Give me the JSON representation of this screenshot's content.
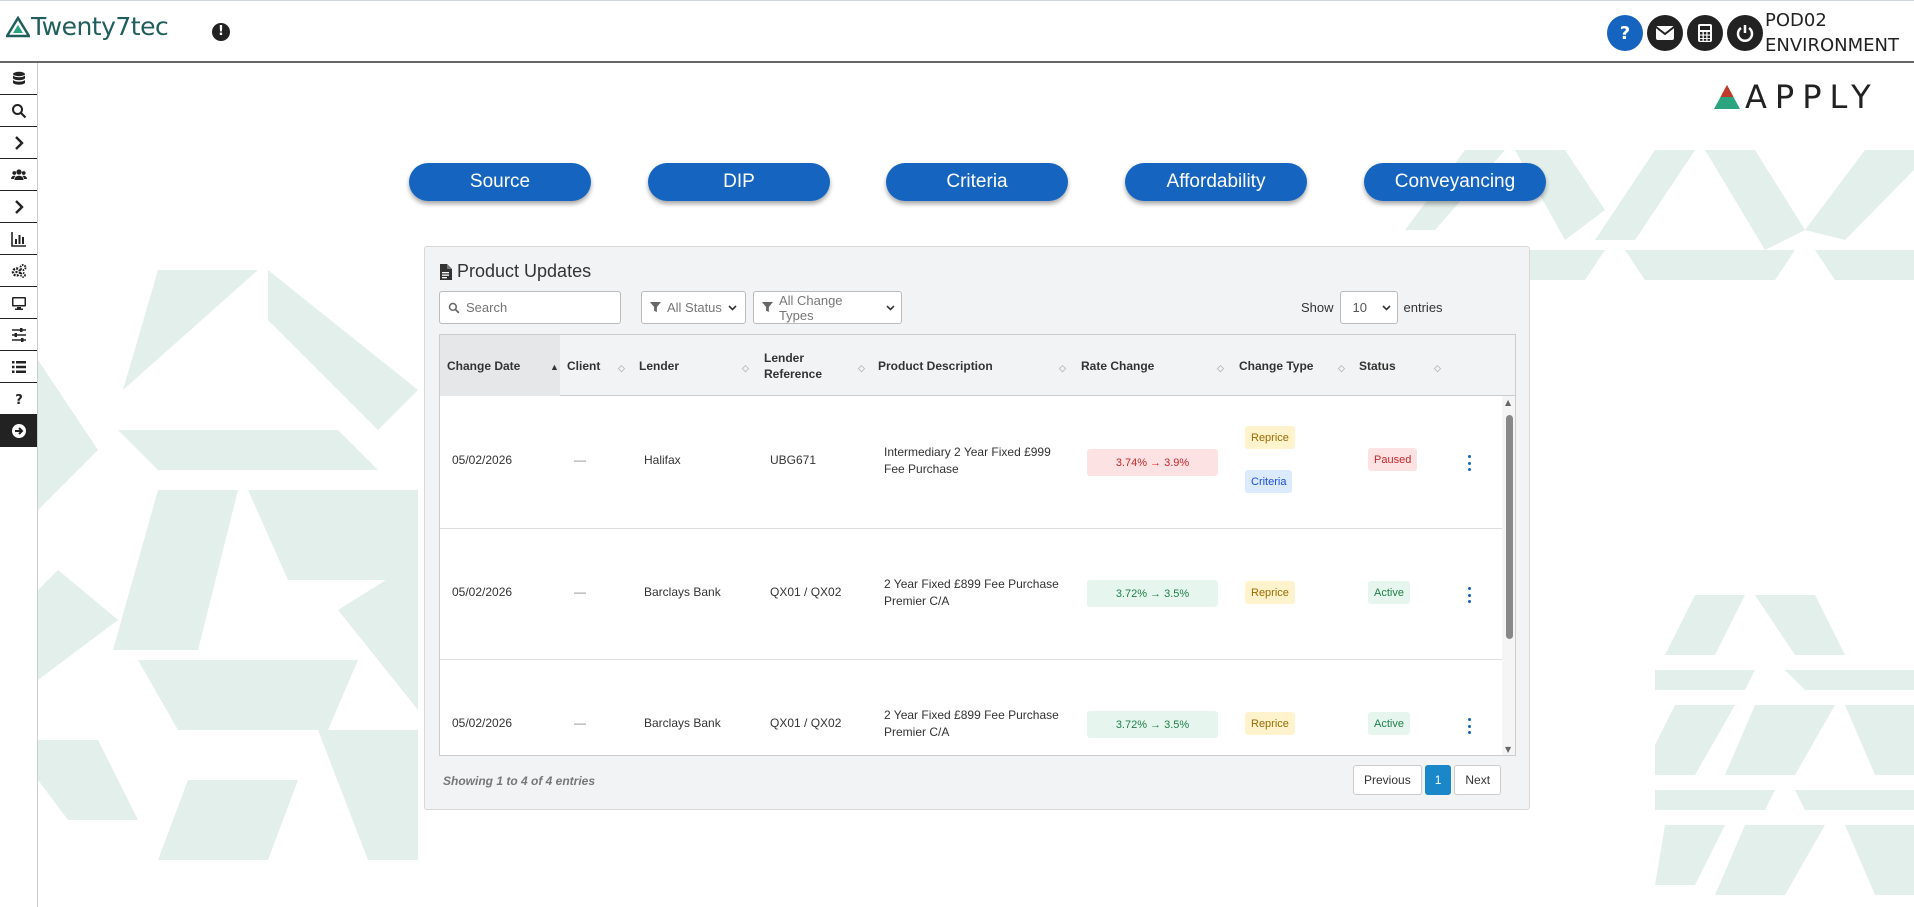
{
  "header": {
    "brand": "Twenty7tec",
    "environment_line1": "POD02",
    "environment_line2": "ENVIRONMENT",
    "icons": [
      "help-icon",
      "envelope-icon",
      "calculator-icon",
      "power-icon"
    ]
  },
  "sidebar": {
    "items": [
      "database-icon",
      "search-icon",
      "chevron-right-icon",
      "users-icon",
      "chevron-right-icon",
      "bar-chart-icon",
      "cogs-icon",
      "monitor-icon",
      "sliders-icon",
      "list-icon",
      "help-icon",
      "arrow-circle-right-icon"
    ]
  },
  "apply_brand": "APPLY",
  "nav": [
    "Source",
    "DIP",
    "Criteria",
    "Affordability",
    "Conveyancing"
  ],
  "panel": {
    "title": "Product Updates",
    "search_placeholder": "Search",
    "status_filter": "All Status",
    "change_type_filter": "All Change Types",
    "show_label": "Show",
    "entries_label": "entries",
    "page_size": "10",
    "columns": [
      "Change Date",
      "Client",
      "Lender",
      "Lender Reference",
      "Product Description",
      "Rate Change",
      "Change Type",
      "Status"
    ],
    "rows": [
      {
        "date": "05/02/2026",
        "client": "—",
        "lender": "Halifax",
        "reference": "UBG671",
        "description": "Intermediary 2 Year Fixed £999 Fee Purchase",
        "rate": "3.74% → 3.9%",
        "rate_direction": "down",
        "change_types": [
          "Reprice",
          "Criteria"
        ],
        "status": "Paused"
      },
      {
        "date": "05/02/2026",
        "client": "—",
        "lender": "Barclays Bank",
        "reference": "QX01 / QX02",
        "description": "2 Year Fixed £899 Fee Purchase Premier C/A",
        "rate": "3.72% → 3.5%",
        "rate_direction": "up",
        "change_types": [
          "Reprice"
        ],
        "status": "Active"
      },
      {
        "date": "05/02/2026",
        "client": "—",
        "lender": "Barclays Bank",
        "reference": "QX01 / QX02",
        "description": "2 Year Fixed £899 Fee Purchase Premier C/A",
        "rate": "3.72% → 3.5%",
        "rate_direction": "up",
        "change_types": [
          "Reprice"
        ],
        "status": "Active"
      }
    ],
    "info": "Showing 1 to 4 of 4 entries",
    "pagination": {
      "previous": "Previous",
      "current": "1",
      "next": "Next"
    }
  },
  "colors": {
    "brand_teal": "#1f5e5b",
    "primary_blue": "#1565c0",
    "pager_blue": "#1a87c9",
    "deco_green": "#e3efea"
  }
}
